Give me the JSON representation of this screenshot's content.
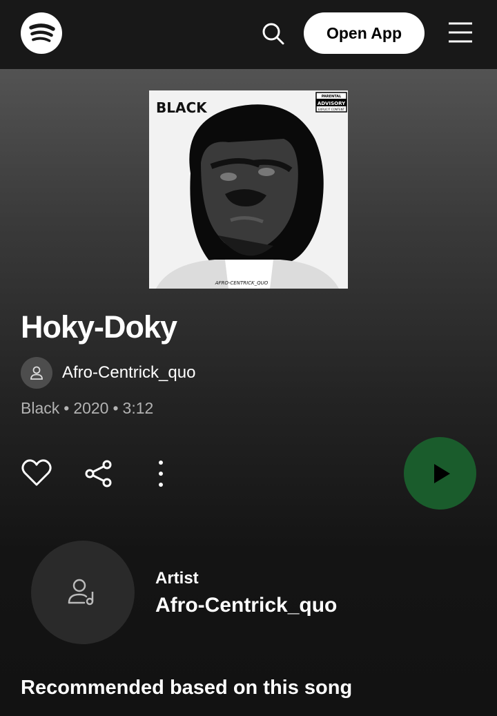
{
  "header": {
    "logo_icon": "spotify-logo-icon",
    "search_icon": "search-icon",
    "open_app_label": "Open App",
    "menu_icon": "hamburger-menu-icon"
  },
  "track": {
    "cover_icon": "album-cover-image",
    "cover_text_title": "BLACK",
    "cover_text_advisory_1": "PARENTAL",
    "cover_text_advisory_2": "ADVISORY",
    "cover_text_advisory_3": "EXPLICIT CONTENT",
    "cover_text_artist": "AFRO-CENTRICK_QUO",
    "title": "Hoky-Doky",
    "artist": "Afro-Centrick_quo",
    "album": "Black",
    "year": "2020",
    "duration": "3:12",
    "separator": "•"
  },
  "actions": {
    "like_icon": "heart-icon",
    "share_icon": "share-icon",
    "more_icon": "more-options-icon",
    "play_icon": "play-icon",
    "play_color": "#1a5c2c"
  },
  "artist_card": {
    "label": "Artist",
    "name": "Afro-Centrick_quo",
    "icon": "artist-music-icon"
  },
  "recommended": {
    "heading": "Recommended based on this song"
  },
  "colors": {
    "background": "#121212",
    "topbar": "#181818",
    "text_secondary": "#b3b3b3"
  }
}
